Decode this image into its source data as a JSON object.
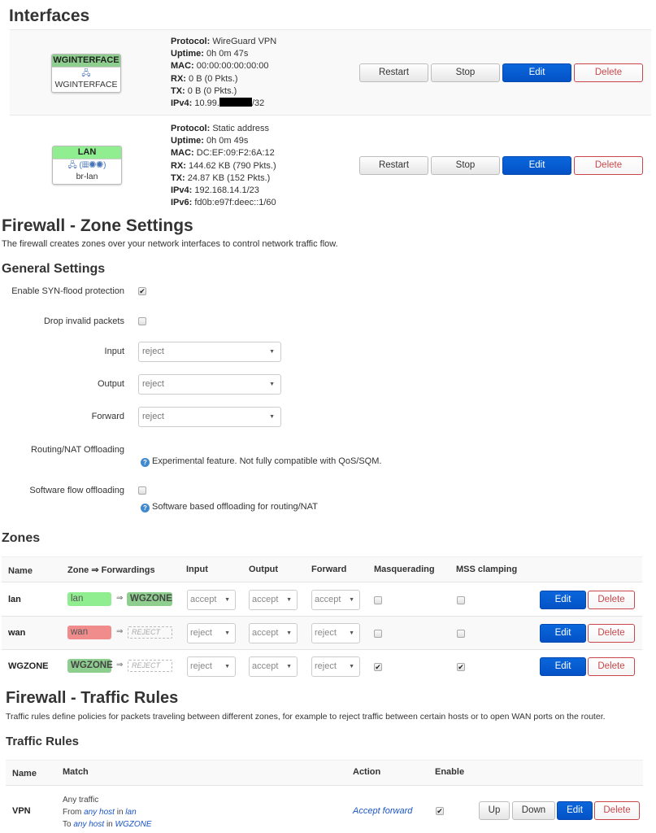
{
  "interfaces": {
    "title": "Interfaces",
    "items": [
      {
        "badge_name": "WGINTERFACE",
        "badge_color": "#8ece8e",
        "icon": "tunnel-icon",
        "device": "WGINTERFACE",
        "info": [
          {
            "label": "Protocol:",
            "value": "WireGuard VPN"
          },
          {
            "label": "Uptime:",
            "value": "0h 0m 47s"
          },
          {
            "label": "MAC:",
            "value": "00:00:00:00:00:00"
          },
          {
            "label": "RX:",
            "value": "0 B (0 Pkts.)"
          },
          {
            "label": "TX:",
            "value": "0 B (0 Pkts.)"
          },
          {
            "label": "IPv4:",
            "value_prefix": "10.99.",
            "value_suffix": "/32"
          }
        ],
        "buttons": {
          "restart": "Restart",
          "stop": "Stop",
          "edit": "Edit",
          "delete": "Delete"
        }
      },
      {
        "badge_name": "LAN",
        "badge_color": "#90ee90",
        "icon": "bridge-icon",
        "icon_text": "(…)",
        "device": "br-lan",
        "info": [
          {
            "label": "Protocol:",
            "value": "Static address"
          },
          {
            "label": "Uptime:",
            "value": "0h 0m 49s"
          },
          {
            "label": "MAC:",
            "value": "DC:EF:09:F2:6A:12"
          },
          {
            "label": "RX:",
            "value": "144.62 KB (790 Pkts.)"
          },
          {
            "label": "TX:",
            "value": "24.87 KB (152 Pkts.)"
          },
          {
            "label": "IPv4:",
            "value": "192.168.14.1/23"
          },
          {
            "label": "IPv6:",
            "value": "fd0b:e97f:deec::1/60"
          }
        ],
        "buttons": {
          "restart": "Restart",
          "stop": "Stop",
          "edit": "Edit",
          "delete": "Delete"
        }
      }
    ]
  },
  "zone_settings": {
    "title": "Firewall - Zone Settings",
    "description": "The firewall creates zones over your network interfaces to control network traffic flow.",
    "general": {
      "title": "General Settings",
      "syn_flood": {
        "label": "Enable SYN-flood protection",
        "checked": true
      },
      "drop_invalid": {
        "label": "Drop invalid packets",
        "checked": false
      },
      "input": {
        "label": "Input",
        "value": "reject"
      },
      "output": {
        "label": "Output",
        "value": "reject"
      },
      "forward": {
        "label": "Forward",
        "value": "reject"
      },
      "nat_offloading": {
        "label": "Routing/NAT Offloading",
        "help": "Experimental feature. Not fully compatible with QoS/SQM."
      },
      "sw_flow": {
        "label": "Software flow offloading",
        "checked": false,
        "help": "Software based offloading for routing/NAT"
      }
    }
  },
  "zones": {
    "title": "Zones",
    "headers": {
      "name": "Name",
      "forwardings": "Zone ⇒ Forwardings",
      "input": "Input",
      "output": "Output",
      "forward": "Forward",
      "masq": "Masquerading",
      "mss": "MSS clamping"
    },
    "rows": [
      {
        "name": "lan",
        "zone": "lan",
        "zone_color": "#90ee90",
        "arrow": "⇒",
        "dest": "WGZONE",
        "dest_color": "#8ece8e",
        "dest_reject": false,
        "input": "accept",
        "output": "accept",
        "forward": "accept",
        "masq": false,
        "mss": false,
        "edit": "Edit",
        "delete": "Delete"
      },
      {
        "name": "wan",
        "zone": "wan",
        "zone_color": "#f08c8c",
        "arrow": "⇒",
        "dest": "REJECT",
        "dest_reject": true,
        "input": "reject",
        "output": "accept",
        "forward": "reject",
        "masq": false,
        "mss": false,
        "edit": "Edit",
        "delete": "Delete"
      },
      {
        "name": "WGZONE",
        "zone": "WGZONE",
        "zone_color": "#8ece8e",
        "arrow": "⇒",
        "dest": "REJECT",
        "dest_reject": true,
        "input": "reject",
        "output": "accept",
        "forward": "reject",
        "masq": true,
        "mss": true,
        "edit": "Edit",
        "delete": "Delete"
      }
    ]
  },
  "traffic_rules": {
    "title": "Firewall - Traffic Rules",
    "description": "Traffic rules define policies for packets traveling between different zones, for example to reject traffic between certain hosts or to open WAN ports on the router.",
    "subtitle": "Traffic Rules",
    "headers": {
      "name": "Name",
      "match": "Match",
      "action": "Action",
      "enable": "Enable"
    },
    "rows": [
      {
        "name": "VPN",
        "match_line1": "Any traffic",
        "from_prefix": "From",
        "from_host": "any host",
        "from_in": "in",
        "from_zone": "lan",
        "to_prefix": "To",
        "to_host": "any host",
        "to_in": "in",
        "to_zone": "WGZONE",
        "action": "Accept forward",
        "enabled": true,
        "up": "Up",
        "down": "Down",
        "edit": "Edit",
        "delete": "Delete"
      }
    ]
  }
}
